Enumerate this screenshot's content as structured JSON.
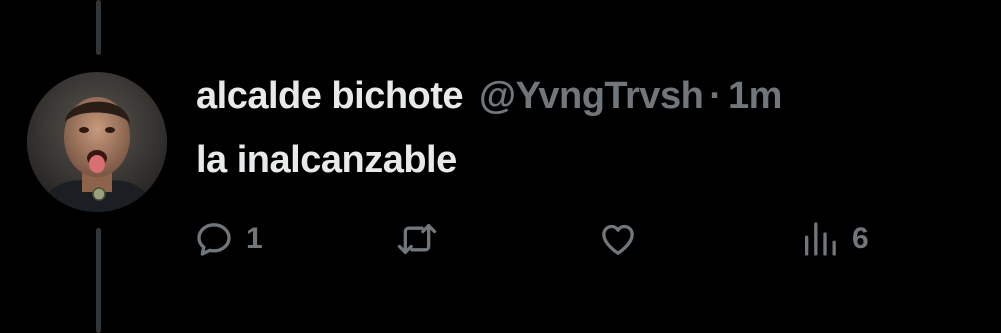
{
  "tweet": {
    "display_name": "alcalde bichote",
    "handle": "@YvngTrvsh",
    "separator": "·",
    "time": "1m",
    "text": "la inalcanzable"
  },
  "actions": {
    "reply": {
      "icon": "reply-icon",
      "count": "1"
    },
    "repost": {
      "icon": "repost-icon",
      "count": ""
    },
    "like": {
      "icon": "heart-icon",
      "count": ""
    },
    "views": {
      "icon": "views-icon",
      "count": "6"
    }
  },
  "colors": {
    "background": "#000000",
    "primary_text": "#e7e9ea",
    "secondary_text": "#71767b",
    "thread_line": "#333639"
  }
}
